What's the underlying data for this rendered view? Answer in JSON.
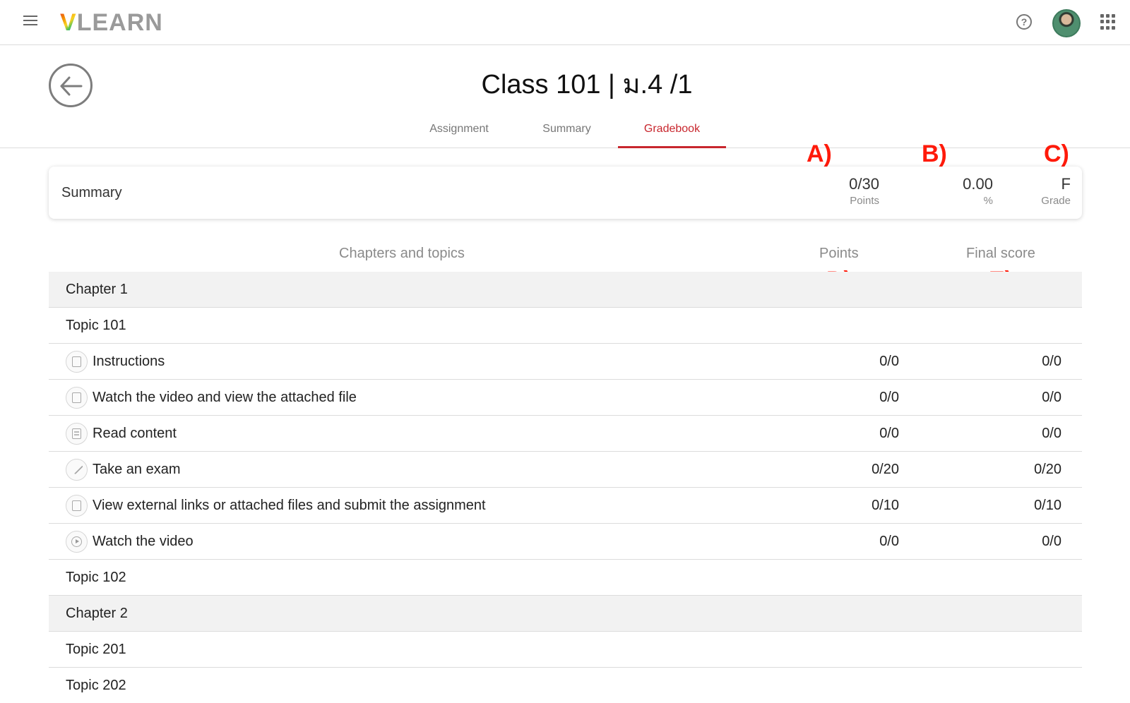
{
  "app": {
    "logo_v": "V",
    "logo_rest": "LEARN"
  },
  "header": {
    "title": "Class 101 | ม.4 /1"
  },
  "tabs": [
    {
      "label": "Assignment",
      "active": false
    },
    {
      "label": "Summary",
      "active": false
    },
    {
      "label": "Gradebook",
      "active": true
    }
  ],
  "annotations": [
    "A)",
    "B)",
    "C)",
    "D)",
    "E)"
  ],
  "summary": {
    "label": "Summary",
    "points_value": "0/30",
    "points_caption": "Points",
    "percent_value": "0.00",
    "percent_caption": "%",
    "grade_value": "F",
    "grade_caption": "Grade"
  },
  "table": {
    "headers": {
      "topics": "Chapters and topics",
      "points": "Points",
      "final": "Final score"
    },
    "rows": [
      {
        "type": "chapter",
        "name": "Chapter 1"
      },
      {
        "type": "topic",
        "name": "Topic 101"
      },
      {
        "type": "item",
        "icon": "clipboard-icon",
        "name": "Instructions",
        "points": "0/0",
        "final": "0/0"
      },
      {
        "type": "item",
        "icon": "clipboard-icon",
        "name": "Watch the video and view the attached file",
        "points": "0/0",
        "final": "0/0"
      },
      {
        "type": "item",
        "icon": "document-icon",
        "name": "Read content",
        "points": "0/0",
        "final": "0/0"
      },
      {
        "type": "item",
        "icon": "pencil-icon",
        "name": "Take an exam",
        "points": "0/20",
        "final": "0/20"
      },
      {
        "type": "item",
        "icon": "clipboard-icon",
        "name": "View external links or attached files and submit the assignment",
        "points": "0/10",
        "final": "0/10"
      },
      {
        "type": "item",
        "icon": "play-icon",
        "name": "Watch the video",
        "points": "0/0",
        "final": "0/0"
      },
      {
        "type": "topic",
        "name": "Topic 102"
      },
      {
        "type": "chapter",
        "name": "Chapter 2"
      },
      {
        "type": "topic",
        "name": "Topic 201"
      },
      {
        "type": "topic",
        "name": "Topic 202"
      }
    ]
  }
}
